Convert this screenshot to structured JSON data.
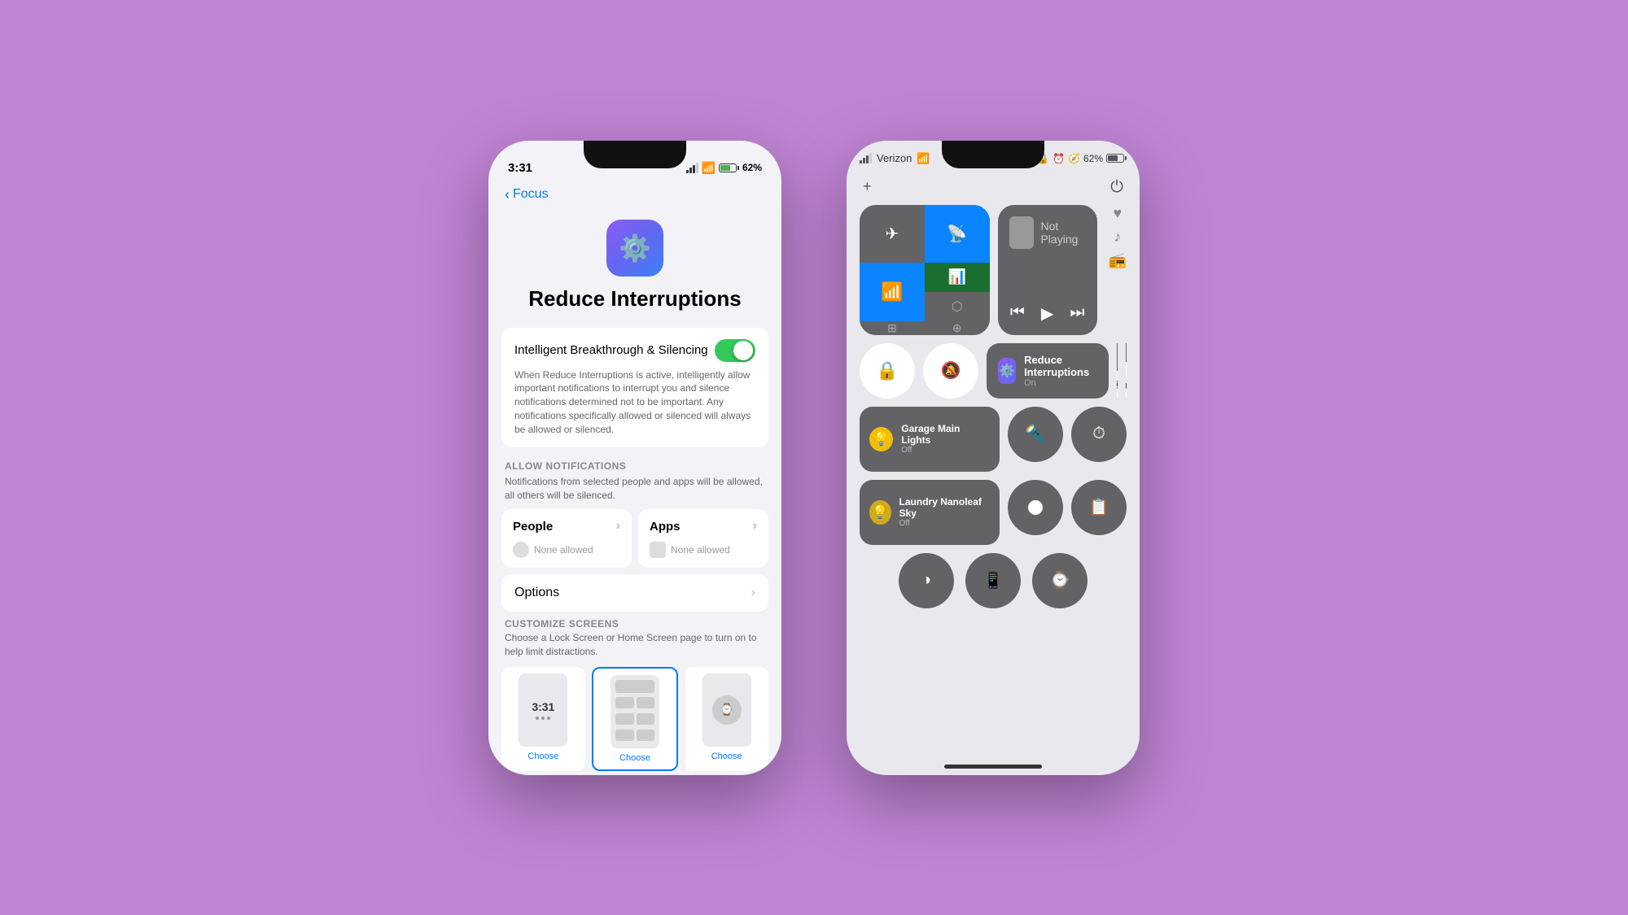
{
  "background_color": "#c084d4",
  "phone1": {
    "status": {
      "time": "3:31",
      "signal": "▪▪▪",
      "wifi": "WiFi",
      "battery": "62%"
    },
    "nav": {
      "back_label": "Focus"
    },
    "icon_gradient": [
      "#8B5CF6",
      "#3B82F6"
    ],
    "title": "Reduce Interruptions",
    "toggle_label": "Intelligent Breakthrough & Silencing",
    "toggle_state": true,
    "toggle_desc": "When Reduce Interruptions is active, intelligently allow important notifications to interrupt you and silence notifications determined not to be important. Any notifications specifically allowed or silenced will always be allowed or silenced.",
    "allow_section_header": "ALLOW NOTIFICATIONS",
    "allow_section_desc": "Notifications from selected people and apps will be allowed, all others will be silenced.",
    "people_label": "People",
    "people_sub": "None allowed",
    "apps_label": "Apps",
    "apps_sub": "None allowed",
    "options_label": "Options",
    "customize_header": "CUSTOMIZE SCREENS",
    "customize_desc": "Choose a Lock Screen or Home Screen page to turn on to help limit distractions.",
    "screen_previews": [
      {
        "type": "lock",
        "time": "3:31",
        "label": "Choose"
      },
      {
        "type": "home",
        "label": "Choose"
      },
      {
        "type": "watch",
        "label": "Choose"
      }
    ]
  },
  "phone2": {
    "status": {
      "carrier": "Verizon",
      "battery_pct": "62%"
    },
    "connectivity": {
      "airplane": "✈",
      "hotspot": "📶",
      "wifi": "📡",
      "cellular_bars": "▪▪▪",
      "bluetooth": "⬡"
    },
    "now_playing_label": "Not Playing",
    "focus": {
      "name": "Reduce Interruptions",
      "name_short": "Reduce Interruptions",
      "status": "On"
    },
    "garage_light": {
      "name": "Garage Main Lights",
      "status": "Off"
    },
    "laundry_light": {
      "name": "Laundry Nanoleaf Sky",
      "status": "Off"
    },
    "bottom_icons": [
      "⬛",
      "📻",
      "⏱"
    ],
    "small_icons": [
      "♥",
      "🎵",
      "📻"
    ]
  }
}
